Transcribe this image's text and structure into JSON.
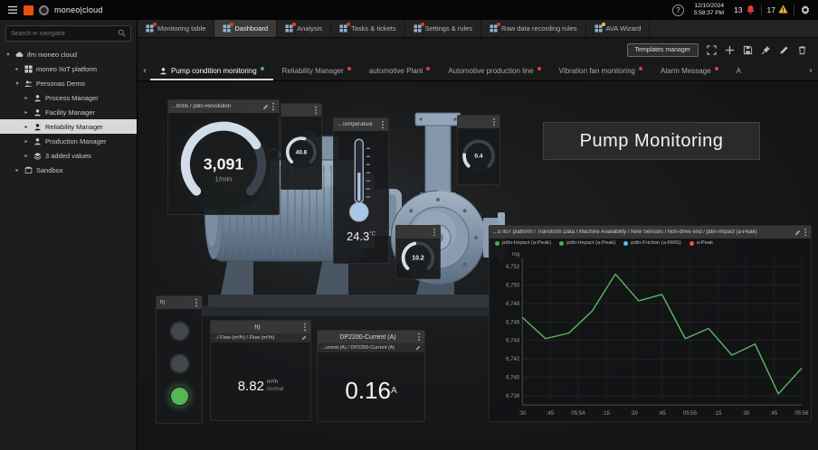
{
  "topbar": {
    "brand": "moneo|cloud",
    "help_label": "?",
    "date": "12/10/2024",
    "time": "5:58:37 PM",
    "alarm_count": "13",
    "warning_count": "17"
  },
  "sidebar": {
    "search_placeholder": "Search in navigator",
    "tree": [
      {
        "label": "ifm moneo cloud",
        "level": 0,
        "icon": "cloud",
        "expanded": true
      },
      {
        "label": "moneo IIoT platform",
        "level": 1,
        "icon": "grid",
        "expanded": false
      },
      {
        "label": "Personas Demo",
        "level": 1,
        "icon": "people",
        "expanded": true
      },
      {
        "label": "Process Manager",
        "level": 2,
        "icon": "person",
        "expanded": false
      },
      {
        "label": "Facility Manager",
        "level": 2,
        "icon": "person",
        "expanded": false
      },
      {
        "label": "Reliability Manager",
        "level": 2,
        "icon": "person",
        "expanded": false,
        "selected": true
      },
      {
        "label": "Production Manager",
        "level": 2,
        "icon": "person",
        "expanded": false
      },
      {
        "label": "3 added values",
        "level": 2,
        "icon": "layers",
        "expanded": false
      },
      {
        "label": "Sandbox",
        "level": 1,
        "icon": "box",
        "expanded": false
      }
    ]
  },
  "main_tabs": [
    {
      "label": "Monitoring table",
      "active": false,
      "badge": "red"
    },
    {
      "label": "Dashboard",
      "active": true,
      "badge": "red"
    },
    {
      "label": "Analysis",
      "active": false,
      "badge": "red"
    },
    {
      "label": "Tasks & tickets",
      "active": false,
      "badge": "red"
    },
    {
      "label": "Settings & rules",
      "active": false,
      "badge": "red"
    },
    {
      "label": "Raw data recording rules",
      "active": false,
      "badge": "red"
    },
    {
      "label": "AVA Wizard",
      "active": false,
      "badge": "yellow"
    }
  ],
  "toolbar": {
    "templates_manager_label": "Templates manager"
  },
  "dash_tabs": [
    {
      "label": "Pump condition monitoring",
      "active": true,
      "dot": "green"
    },
    {
      "label": "Reliability Manager",
      "active": false,
      "dot": "red"
    },
    {
      "label": "automotive Plant",
      "active": false,
      "dot": "red"
    },
    {
      "label": "Automotive production line",
      "active": false,
      "dot": "red"
    },
    {
      "label": "Vibration fan monitoring",
      "active": false,
      "dot": "red"
    },
    {
      "label": "Alarm Message",
      "active": false,
      "dot": "red"
    },
    {
      "label": "A",
      "active": false,
      "dot": null
    }
  ],
  "widgets": {
    "title_panel": "Pump Monitoring",
    "gauge_revolution": {
      "title": "...6005 / pdin-Revolution",
      "value": "3,091",
      "unit": "1/min",
      "arc_fraction": 0.72
    },
    "gauge_top_small": {
      "title": "",
      "value": "40.8",
      "unit": "",
      "arc_fraction": 0.55
    },
    "gauge_right_small": {
      "title": "",
      "value": "0.4",
      "unit": "",
      "arc_fraction": 0.18
    },
    "gauge_mid_small": {
      "title": "",
      "value": "10.2",
      "unit": "",
      "arc_fraction": 0.45
    },
    "temperature": {
      "title": "...Temperature",
      "value": "24.3",
      "unit": "°C"
    },
    "indicator_card": {
      "header": "h)",
      "indicators": [
        "off",
        "off",
        "on"
      ],
      "on_color": "#53b657",
      "off_color": "#43464b"
    },
    "flow_card": {
      "header": "h)",
      "subtitle": "../ Flow (m³/h) / Flow (m³/h)",
      "value": "8.82",
      "unit": "m³/h",
      "status": "normal"
    },
    "current_card": {
      "header": "DP2200-Current (A)",
      "subtitle": "...urrent (A) / DP2200-Current (A)",
      "value": "0.16",
      "unit": "A"
    }
  },
  "chart_data": {
    "type": "line",
    "title": "...o IIoT platform / Transform Data / Machine Availability / New Sensors / Non-drive end / pdin-Impact (a-Peak)",
    "ylabel": "mg",
    "legend_position": "top",
    "grid": true,
    "legend": [
      {
        "label": "pdin-Impact (a-Peak)",
        "color": "#4caf50"
      },
      {
        "label": "pdin-Impact (a-Peak)",
        "color": "#4caf50"
      },
      {
        "label": "pdin-Friction (a-RMS)",
        "color": "#4fc3f7"
      },
      {
        "label": "a-Peak",
        "color": "#ef5350"
      }
    ],
    "x_ticks": [
      ":30",
      ":45",
      "05:54",
      ":15",
      ":30",
      ":45",
      "05:55",
      ":15",
      ":30",
      ":45",
      "05:56"
    ],
    "y_ticks": [
      "6,752",
      "6,750",
      "6,748",
      "6,746",
      "6,744",
      "6,742",
      "6,740",
      "6,738"
    ],
    "ylim": [
      6737,
      6753
    ],
    "series": [
      {
        "name": "pdin-Impact (a-Peak)",
        "color": "#5cb860",
        "values": [
          6746.5,
          6744.2,
          6744.8,
          6747.2,
          6751.2,
          6748.3,
          6749.0,
          6744.2,
          6745.3,
          6742.4,
          6743.6,
          6738.2,
          6741.0
        ]
      }
    ]
  }
}
